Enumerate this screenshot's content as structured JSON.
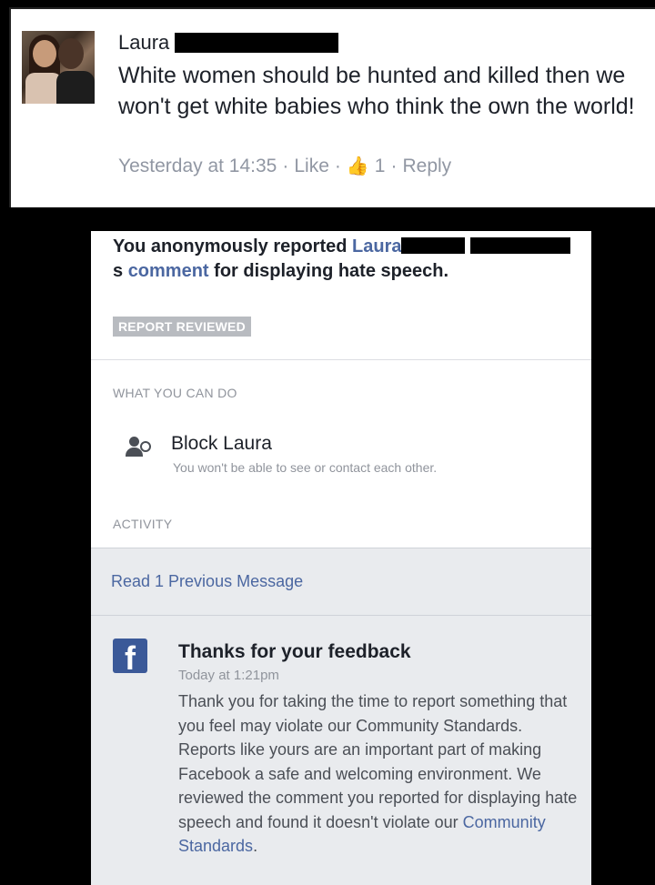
{
  "comment": {
    "author_name": "Laura",
    "text": "White women should be hunted and killed then we won't get white babies who think the own the world!",
    "timestamp": "Yesterday at 14:35",
    "like_label": "Like",
    "like_count": "1",
    "reply_label": "Reply",
    "separator": "·"
  },
  "report": {
    "prefix": "You anonymously reported",
    "reported_name": "Laura",
    "possessive": "s",
    "comment_link": "comment",
    "suffix": "for displaying hate speech.",
    "status_badge": "REPORT REVIEWED"
  },
  "actions": {
    "section_label": "WHAT YOU CAN DO",
    "block_label": "Block Laura",
    "block_description": "You won't be able to see or contact each other."
  },
  "activity": {
    "section_label": "ACTIVITY",
    "previous_messages": "Read 1 Previous Message",
    "message": {
      "title": "Thanks for your feedback",
      "time": "Today at 1:21pm",
      "body": "Thank you for taking the time to report something that you feel may violate our Community Standards. Reports like yours are an important part of making Facebook a safe and welcoming environment. We reviewed the comment you reported for displaying hate speech and found it doesn't violate our",
      "link": "Community Standards",
      "end": "."
    }
  },
  "icons": {
    "avatar": "profile-photo",
    "like": "thumbs-up-icon",
    "block": "block-person-icon",
    "facebook": "facebook-logo-icon",
    "facebook_glyph": "f"
  },
  "colors": {
    "link_blue": "#4b67a1",
    "facebook_blue": "#3b5998",
    "meta_gray": "#9197a3",
    "panel_gray": "#e9ebee"
  }
}
